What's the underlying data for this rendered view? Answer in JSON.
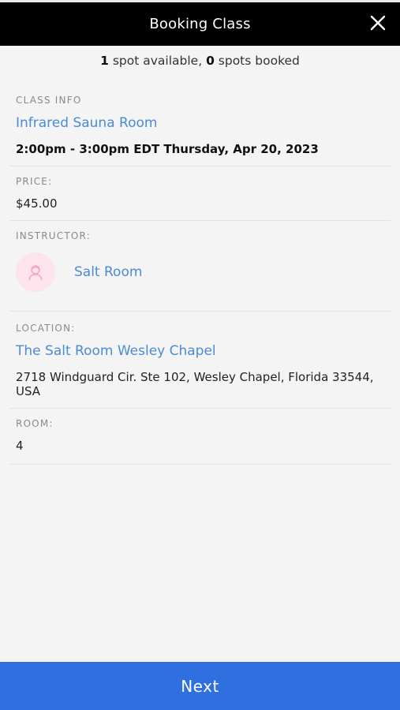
{
  "header": {
    "title": "Booking Class",
    "close_icon": "close-icon"
  },
  "availability": {
    "spots_available_count": "1",
    "spots_available_text": " spot available, ",
    "spots_booked_count": "0",
    "spots_booked_text": " spots booked"
  },
  "class_info": {
    "label": "CLASS INFO",
    "name": "Infrared Sauna Room",
    "datetime": "2:00pm - 3:00pm EDT Thursday, Apr 20, 2023"
  },
  "price": {
    "label": "PRICE:",
    "value": "$45.00"
  },
  "instructor": {
    "label": "INSTRUCTOR:",
    "name": "Salt Room",
    "avatar_icon": "person-icon",
    "avatar_color": "#fde4ec"
  },
  "location": {
    "label": "LOCATION:",
    "name": "The Salt Room Wesley Chapel",
    "address": "2718 Windguard Cir. Ste 102, Wesley Chapel, Florida 33544, USA"
  },
  "room": {
    "label": "ROOM:",
    "value": "4"
  },
  "footer": {
    "next_label": "Next",
    "accent": "#2f6fe0"
  },
  "colors": {
    "link": "#4a8bd4",
    "header_bg": "#000000"
  }
}
